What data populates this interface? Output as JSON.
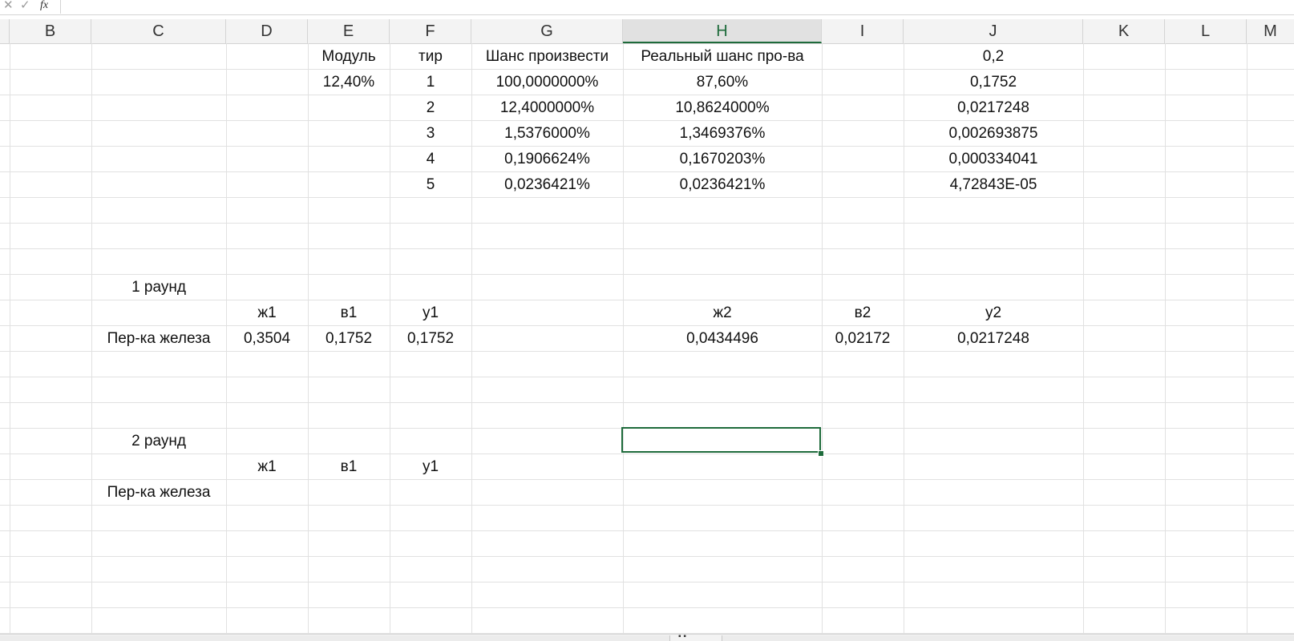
{
  "formula_bar": {
    "cancel_icon": "close-icon",
    "confirm_icon": "check-icon",
    "fx_label": "fx",
    "value": ""
  },
  "columns": {
    "B": "B",
    "C": "C",
    "D": "D",
    "E": "E",
    "F": "F",
    "G": "G",
    "H": "H",
    "I": "I",
    "J": "J",
    "K": "K",
    "L": "L",
    "M": "M"
  },
  "active_column": "H",
  "header_row": {
    "E": "Модуль",
    "F": "тир",
    "G": "Шанс произвести",
    "H": "Реальный шанс про-ва",
    "J": "0,2"
  },
  "module_value": "12,40%",
  "tier_rows": [
    {
      "tier": "1",
      "chance": "100,0000000%",
      "real": "87,60%",
      "j": "0,1752"
    },
    {
      "tier": "2",
      "chance": "12,4000000%",
      "real": "10,8624000%",
      "j": "0,0217248"
    },
    {
      "tier": "3",
      "chance": "1,5376000%",
      "real": "1,3469376%",
      "j": "0,002693875"
    },
    {
      "tier": "4",
      "chance": "0,1906624%",
      "real": "0,1670203%",
      "j": "0,000334041"
    },
    {
      "tier": "5",
      "chance": "0,0236421%",
      "real": "0,0236421%",
      "j": "4,72843E-05"
    }
  ],
  "round1": {
    "title": "1 раунд",
    "headers": {
      "D": "ж1",
      "E": "в1",
      "F": "у1",
      "H": "ж2",
      "I": "в2",
      "J": "у2"
    },
    "row_label": "Пер-ка железа",
    "values": {
      "D": "0,3504",
      "E": "0,1752",
      "F": "0,1752",
      "H": "0,0434496",
      "I": "0,02172",
      "J": "0,0217248"
    }
  },
  "round2": {
    "title": "2 раунд",
    "headers": {
      "D": "ж1",
      "E": "в1",
      "F": "у1"
    },
    "row_label": "Пер-ка железа"
  },
  "selected_cell": "H",
  "accent_color": "#1e6b3b"
}
